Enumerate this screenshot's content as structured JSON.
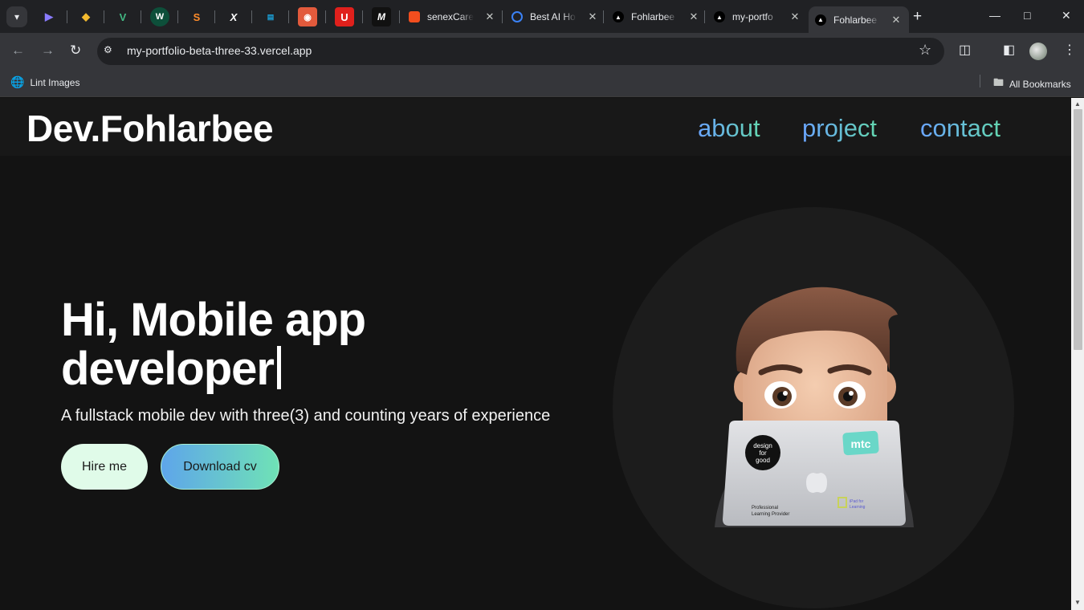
{
  "browser": {
    "tabs": [
      {
        "label": "senexCare",
        "favicon": "figma-icon"
      },
      {
        "label": "Best AI Ho",
        "favicon": "blue-ring-icon"
      },
      {
        "label": "Fohlarbee",
        "favicon": "vercel-icon"
      },
      {
        "label": "my-portfo",
        "favicon": "vercel-icon"
      },
      {
        "label": "Fohlarbee",
        "favicon": "vercel-icon",
        "active": true
      }
    ],
    "url": "my-portfolio-beta-three-33.vercel.app",
    "bookmarks": {
      "left_item": "Lint Images",
      "right_item": "All Bookmarks"
    }
  },
  "site": {
    "logo": "Dev.Fohlarbee",
    "nav": {
      "about": "about",
      "project": "project",
      "contact": "contact"
    },
    "hero": {
      "title_line1": "Hi, Mobile app",
      "title_line2": "developer",
      "subtitle": "A fullstack mobile dev with three(3) and counting years of experience",
      "hire_button": "Hire me",
      "cv_button": "Download cv"
    },
    "laptop_stickers": {
      "sticker1": "design for good",
      "sticker2": "mtc",
      "sticker3": "Professional Learning Provider",
      "sticker4": "iPad for Learning"
    }
  },
  "colors": {
    "background": "#131313",
    "header": "#181818",
    "nav_gradient_start": "#6aa5ff",
    "nav_gradient_end": "#63d6b0",
    "hire_button": "#e0fbe9"
  }
}
